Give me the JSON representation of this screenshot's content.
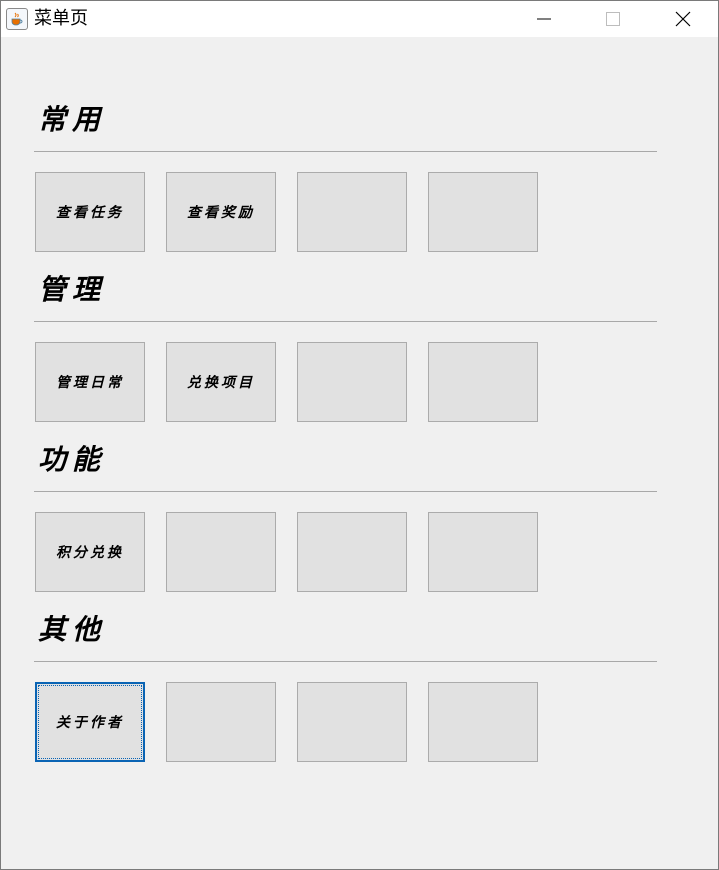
{
  "window": {
    "title": "菜单页",
    "icon": "java-cup-icon",
    "controls": [
      "minimize-icon",
      "maximize-icon",
      "close-icon"
    ]
  },
  "sections": [
    {
      "title": "常用",
      "buttons": [
        "查看任务",
        "查看奖励",
        "",
        ""
      ]
    },
    {
      "title": "管理",
      "buttons": [
        "管理日常",
        "兑换项目",
        "",
        ""
      ]
    },
    {
      "title": "功能",
      "buttons": [
        "积分兑换",
        "",
        "",
        ""
      ]
    },
    {
      "title": "其他",
      "buttons": [
        "关于作者",
        "",
        "",
        ""
      ]
    }
  ],
  "focused_button": "关于作者",
  "colors": {
    "window_bg": "#f0f0f0",
    "button_bg": "#e1e1e1",
    "focus": "#0a64b4"
  }
}
